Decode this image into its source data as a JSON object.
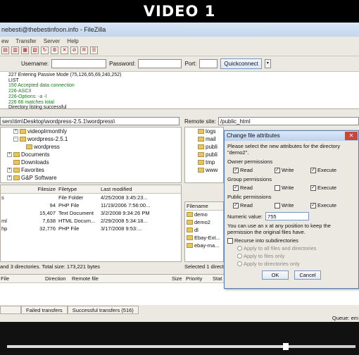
{
  "banner": "VIDEO 1",
  "window": {
    "title": "nebesti@thebestinfoon.info - FileZilla",
    "menu": [
      "ew",
      "Transfer",
      "Server",
      "Help"
    ]
  },
  "quickconnect": {
    "username_label": "Username:",
    "password_label": "Password:",
    "port_label": "Port:",
    "button": "Quickconnect",
    "arrow": "▾"
  },
  "log": [
    {
      "text": "227 Entering Passive Mode (75,126,65,69,240,252)",
      "cmd": false
    },
    {
      "text": "LIST",
      "cmd": false
    },
    {
      "text": "150 Accepted data connection",
      "cmd": true
    },
    {
      "text": "226-ASCII",
      "cmd": true
    },
    {
      "text": "226-Options: -a -l",
      "cmd": true
    },
    {
      "text": "226 66 matches total",
      "cmd": true
    },
    {
      "text": "Directory listing successful",
      "cmd": false
    }
  ],
  "local": {
    "path": "sers\\tim\\Desktop\\wordpress-2.5.1\\wordpress\\",
    "tree": [
      {
        "label": "videoplrmonthly",
        "indent": 2,
        "twisty": "+"
      },
      {
        "label": "wordpress-2.5.1",
        "indent": 2,
        "twisty": "-"
      },
      {
        "label": "wordpress",
        "indent": 3,
        "twisty": ""
      },
      {
        "label": "Documents",
        "indent": 1,
        "twisty": "+"
      },
      {
        "label": "Downloads",
        "indent": 1,
        "twisty": ""
      },
      {
        "label": "Favorites",
        "indent": 1,
        "twisty": "+"
      },
      {
        "label": "G&P Software",
        "indent": 1,
        "twisty": "+"
      }
    ],
    "columns": [
      "Filesize",
      "Filetype",
      "Last modified"
    ],
    "rows": [
      {
        "name": "s",
        "size": "",
        "type": "File Folder",
        "mod": "4/25/2008 3:45:23..."
      },
      {
        "name": "",
        "size": "94",
        "type": "PHP File",
        "mod": "11/19/2006 7:56:00..."
      },
      {
        "name": "",
        "size": "15,407",
        "type": "Text Document",
        "mod": "3/2/2008 9:34:26 PM"
      },
      {
        "name": "ml",
        "size": "7,638",
        "type": "HTML Docum...",
        "mod": "2/29/2008 5:34:18..."
      },
      {
        "name": "hp",
        "size": "32,776",
        "type": "PHP File",
        "mod": "3/17/2008 9:53:..."
      }
    ],
    "status": "and 3 directories. Total size: 173,221 bytes"
  },
  "remote": {
    "site_label": "Remote site:",
    "path": "/public_html",
    "tree": [
      "logs",
      "mail",
      "publi",
      "publi",
      "tmp",
      "www"
    ],
    "column": "Filename",
    "files": [
      "demo",
      "demo2",
      "dl",
      "Ebay-Ext...",
      "ebay-ma..."
    ],
    "status": "Selected 1 direct"
  },
  "queue": {
    "columns": [
      "File",
      "Direction",
      "Remote file",
      "Size",
      "Priority",
      "Stat"
    ],
    "tabs": [
      "Failed transfers",
      "Successful transfers (516)"
    ],
    "status": "Queue: em"
  },
  "dialog": {
    "title": "Change file attributes",
    "close": "✕",
    "desc": "Please select the new attributes for the directory \"demo2\".",
    "groups": [
      {
        "label": "Owner permissions",
        "read": true,
        "write": true,
        "execute": true
      },
      {
        "label": "Group permissions",
        "read": true,
        "write": false,
        "execute": true
      },
      {
        "label": "Public permissions",
        "read": true,
        "write": false,
        "execute": true
      }
    ],
    "read_label": "Read",
    "write_label": "Write",
    "execute_label": "Execute",
    "numeric_label": "Numeric value:",
    "numeric_value": "755",
    "hint": "You can use an x at any position to keep the permission the original files have.",
    "recurse_label": "Recurse into subdirectories",
    "radio": [
      "Apply to all files and directories",
      "Apply to files only",
      "Apply to directories only"
    ],
    "ok": "OK",
    "cancel": "Cancel"
  },
  "player": {
    "progress_fraction": 0.8
  }
}
